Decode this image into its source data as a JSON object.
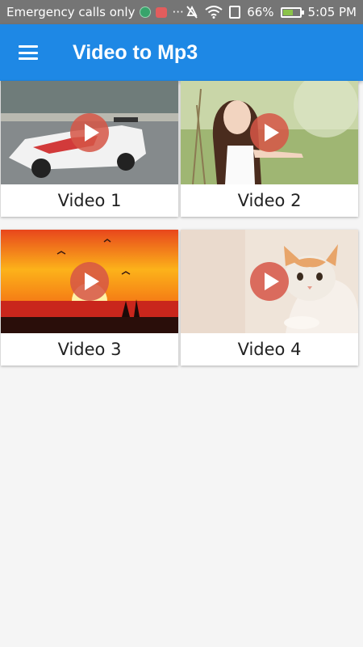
{
  "status_bar": {
    "left_text": "Emergency calls only",
    "more": "···",
    "battery": "66%",
    "battery_level": 0.66,
    "time": "5:05 PM",
    "icons": [
      "globe-icon",
      "message-icon",
      "mute-icon",
      "wifi-icon",
      "sim-icon",
      "battery-icon"
    ]
  },
  "app_bar": {
    "title": "Video to Mp3",
    "menu_icon": "hamburger-menu-icon",
    "color": "#1e88e5"
  },
  "videos": [
    {
      "label": "Video 1",
      "thumbnail": "race-car"
    },
    {
      "label": "Video 2",
      "thumbnail": "girl-in-field"
    },
    {
      "label": "Video 3",
      "thumbnail": "sunset-beach"
    },
    {
      "label": "Video 4",
      "thumbnail": "kitten"
    }
  ],
  "colors": {
    "play_button": "#d65646",
    "background": "#f5f5f5"
  }
}
